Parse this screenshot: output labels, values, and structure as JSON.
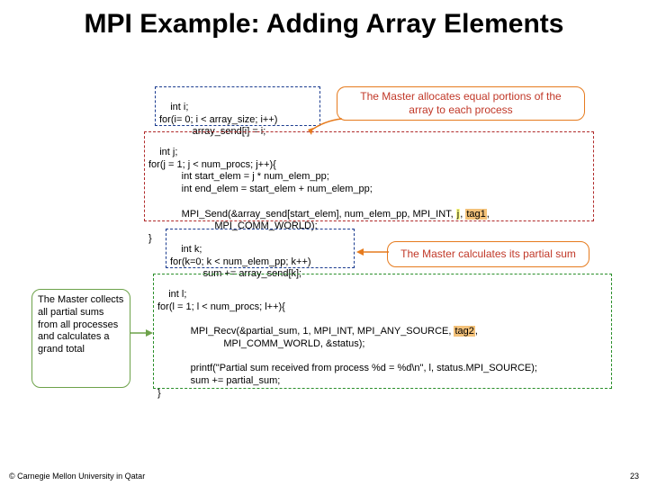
{
  "title": "MPI Example: Adding Array Elements",
  "callouts": {
    "top": "The Master allocates equal portions of the\narray to each process",
    "right": "The Master calculates its partial sum",
    "left": "The Master collects all partial sums from all processes and calculates a grand total"
  },
  "code": {
    "box1": "int i;\nfor(i= 0; i < array_size; i++)\n            array_send[i] = i;",
    "box2_pre": "int j;\nfor(j = 1; j < num_procs; j++){\n            int start_elem = j * num_elem_pp;\n            int end_elem = start_elem + num_elem_pp;\n\n            MPI_Send(&array_send[start_elem], num_elem_pp, MPI_INT, ",
    "box2_hl1": "j",
    "box2_mid": ", ",
    "box2_hl2": "tag1",
    "box2_post": ",\n                        MPI_COMM_WORLD);\n}",
    "box3": "int k;\nfor(k=0; k < num_elem_pp; k++)\n            sum += array_send[k];",
    "box4_pre": "int l;\nfor(l = 1; l < num_procs; l++){\n\n            MPI_Recv(&partial_sum, 1, MPI_INT, MPI_ANY_SOURCE, ",
    "box4_hl": "tag2",
    "box4_post": ",\n                        MPI_COMM_WORLD, &status);\n\n            printf(\"Partial sum received from process %d = %d\\n\", l, status.MPI_SOURCE);\n            sum += partial_sum;\n}"
  },
  "footer": {
    "left": "© Carnegie Mellon University in Qatar",
    "right": "23"
  }
}
